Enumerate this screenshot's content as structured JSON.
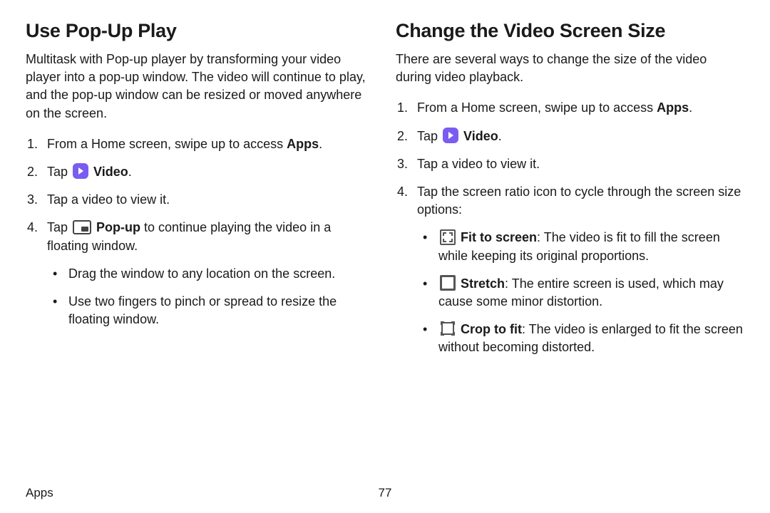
{
  "footer": {
    "section": "Apps",
    "page": "77"
  },
  "left": {
    "heading": "Use Pop-Up Play",
    "intro": "Multitask with Pop-up player by transforming your video player into a pop-up window. The video will continue to play, and the pop-up window can be resized or moved anywhere on the screen.",
    "s1_a": "From a Home screen, swipe up to access ",
    "s1_b": "Apps",
    "s1_c": ".",
    "s2_a": "Tap ",
    "s2_b": "Video",
    "s2_c": ".",
    "s3": "Tap a video to view it.",
    "s4_a": "Tap ",
    "s4_b": "Pop-up",
    "s4_c": " to continue playing the video in a floating window.",
    "b1": "Drag the window to any location on the screen.",
    "b2": "Use two fingers to pinch or spread to resize the floating window."
  },
  "right": {
    "heading": "Change the Video Screen Size",
    "intro": "There are several ways to change the size of the video during video playback.",
    "s1_a": "From a Home screen, swipe up to access ",
    "s1_b": "Apps",
    "s1_c": ".",
    "s2_a": "Tap ",
    "s2_b": "Video",
    "s2_c": ".",
    "s3": "Tap a video to view it.",
    "s4": "Tap the screen ratio icon to cycle through the screen size options:",
    "o1_a": "Fit to screen",
    "o1_b": ": The video is fit to fill the screen while keeping its original proportions.",
    "o2_a": "Stretch",
    "o2_b": ": The entire screen is used, which may cause some minor distortion.",
    "o3_a": "Crop to fit",
    "o3_b": ": The video is enlarged to fit the screen without becoming distorted."
  }
}
